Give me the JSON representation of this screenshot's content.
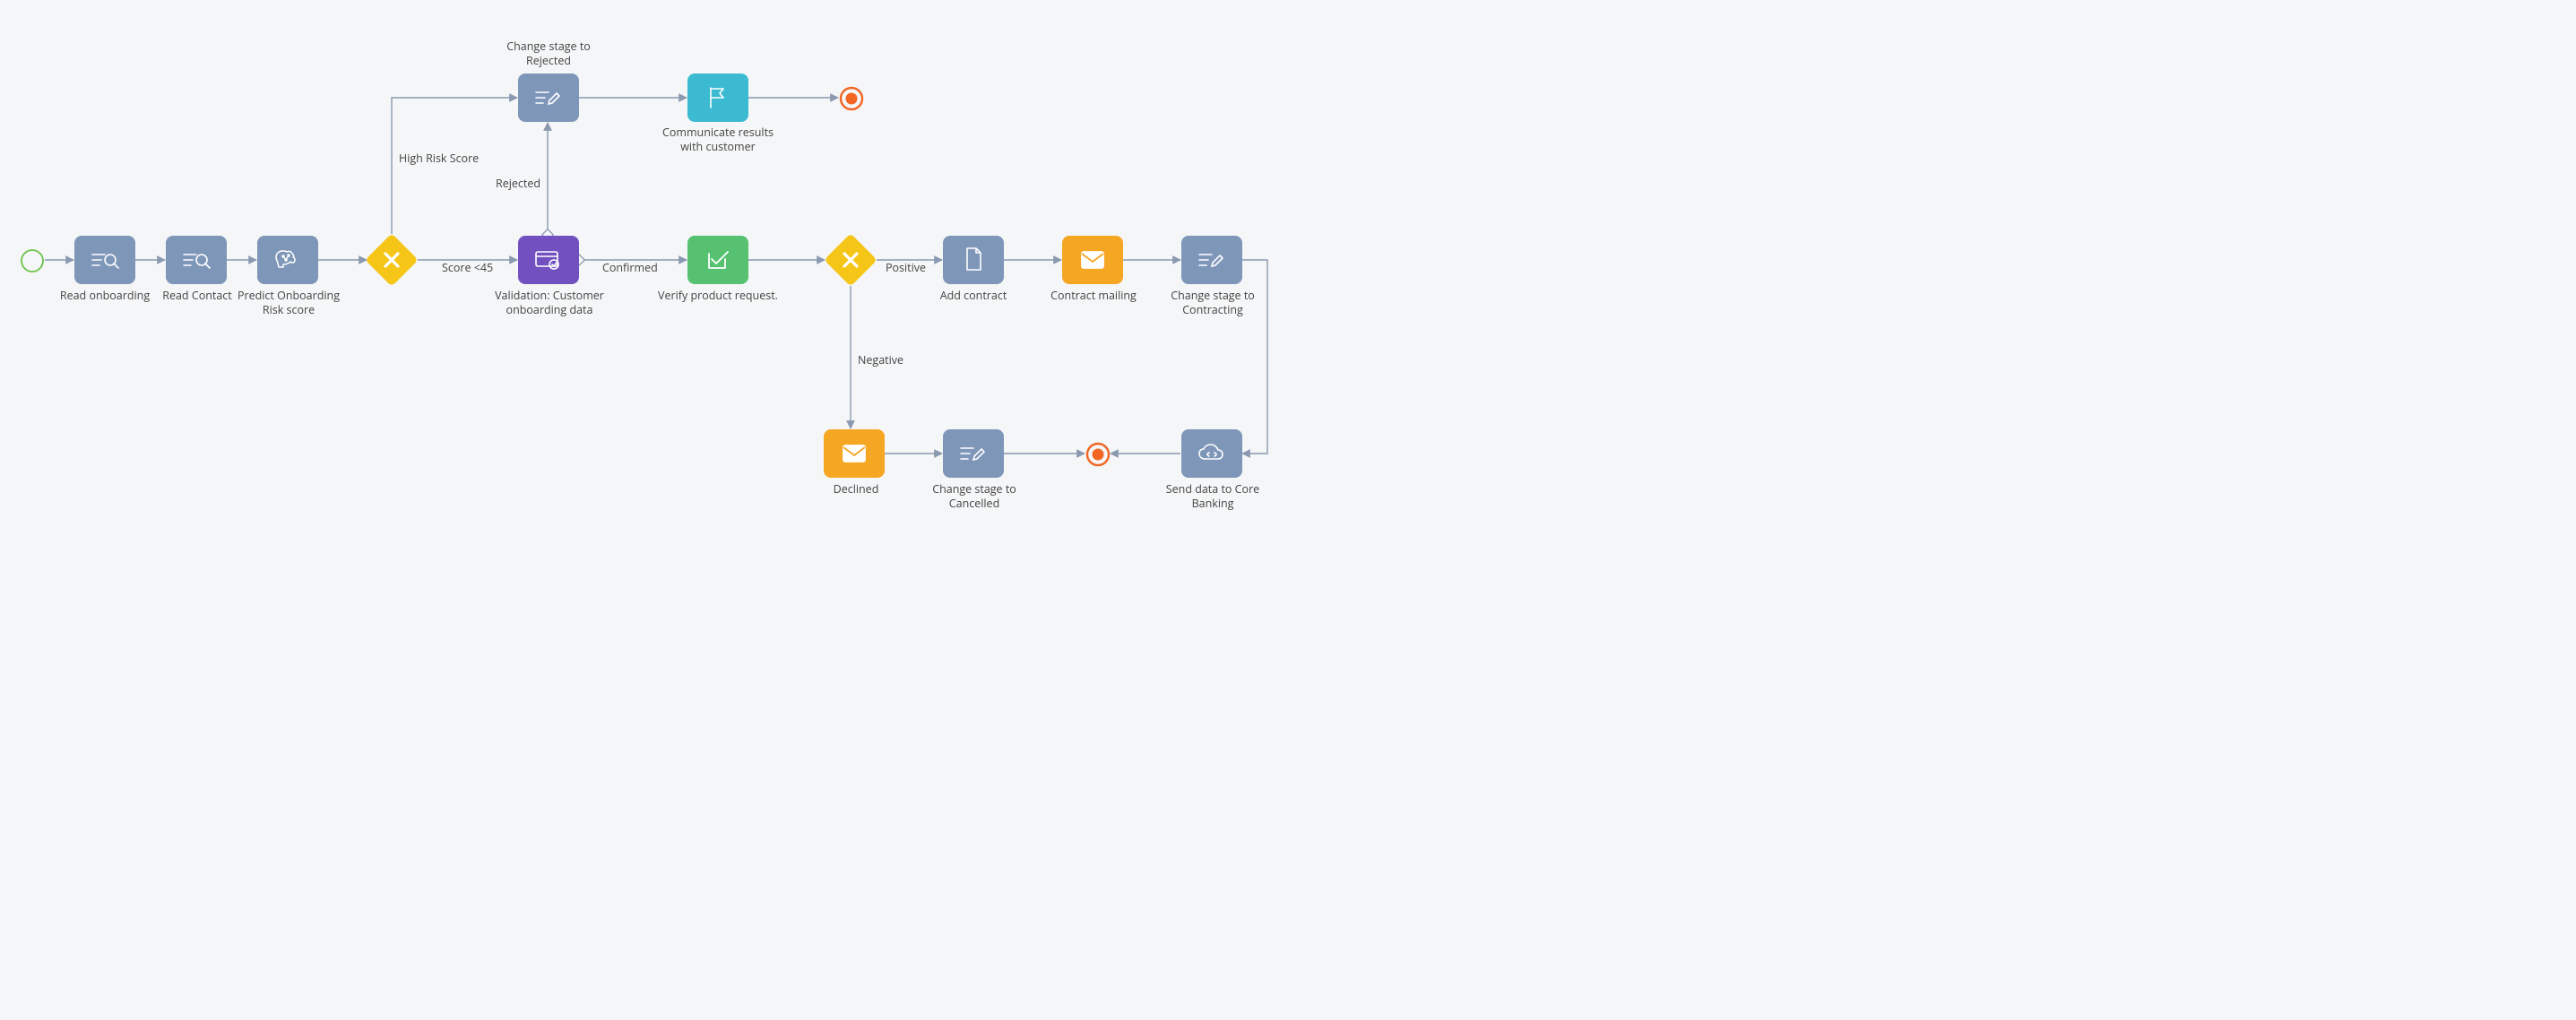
{
  "diagram": {
    "nodes": {
      "start": {
        "type": "start_event",
        "label": ""
      },
      "read_onboarding": {
        "type": "read_task",
        "label": "Read onboarding",
        "icon": "search-list"
      },
      "read_contact": {
        "type": "read_task",
        "label": "Read Contact",
        "icon": "search-list"
      },
      "predict_risk": {
        "type": "ml_task",
        "label": "Predict Onboarding Risk score",
        "icon": "brain"
      },
      "gateway_score": {
        "type": "exclusive_gateway",
        "label": ""
      },
      "change_stage_rejected": {
        "type": "script_task",
        "label": "Change stage to Rejected",
        "icon": "edit-list"
      },
      "validation": {
        "type": "user_task",
        "label": "Validation: Customer onboarding data",
        "icon": "card-check"
      },
      "communicate": {
        "type": "user_task",
        "label": "Communicate results with customer",
        "icon": "flag"
      },
      "terminate_top": {
        "type": "terminate_end",
        "label": ""
      },
      "verify_product": {
        "type": "service_task",
        "label": "Verify product request.",
        "icon": "check-box"
      },
      "gateway_verify": {
        "type": "exclusive_gateway",
        "label": ""
      },
      "add_contract": {
        "type": "service_task",
        "label": "Add contract",
        "icon": "document"
      },
      "contract_mailing": {
        "type": "send_task",
        "label": "Contract mailing",
        "icon": "mail"
      },
      "change_stage_contracting": {
        "type": "script_task",
        "label": "Change stage to Contracting",
        "icon": "edit-list"
      },
      "send_core_banking": {
        "type": "service_task",
        "label": "Send data to Core Banking",
        "icon": "cloud-code"
      },
      "terminate_mid": {
        "type": "terminate_end",
        "label": ""
      },
      "change_stage_cancelled": {
        "type": "script_task",
        "label": "Change stage to Cancelled",
        "icon": "edit-list"
      },
      "declined": {
        "type": "send_task",
        "label": "Declined",
        "icon": "mail"
      }
    },
    "edge_labels": {
      "high_risk": "High Risk Score",
      "score_lt_45": "Score <45",
      "rejected": "Rejected",
      "confirmed": "Confirmed",
      "positive": "Positive",
      "negative": "Negative"
    },
    "flows": [
      {
        "from": "start",
        "to": "read_onboarding"
      },
      {
        "from": "read_onboarding",
        "to": "read_contact"
      },
      {
        "from": "read_contact",
        "to": "predict_risk"
      },
      {
        "from": "predict_risk",
        "to": "gateway_score"
      },
      {
        "from": "gateway_score",
        "to": "change_stage_rejected",
        "label": "High_risk"
      },
      {
        "from": "gateway_score",
        "to": "validation",
        "label": "score_lt_45"
      },
      {
        "from": "validation",
        "to": "change_stage_rejected",
        "label": "rejected"
      },
      {
        "from": "validation",
        "to": "verify_product",
        "label": "confirmed"
      },
      {
        "from": "change_stage_rejected",
        "to": "communicate"
      },
      {
        "from": "communicate",
        "to": "terminate_top"
      },
      {
        "from": "verify_product",
        "to": "gateway_verify"
      },
      {
        "from": "gateway_verify",
        "to": "add_contract",
        "label": "positive"
      },
      {
        "from": "gateway_verify",
        "to": "declined",
        "label": "negative"
      },
      {
        "from": "add_contract",
        "to": "contract_mailing"
      },
      {
        "from": "contract_mailing",
        "to": "change_stage_contracting"
      },
      {
        "from": "change_stage_contracting",
        "to": "send_core_banking"
      },
      {
        "from": "send_core_banking",
        "to": "terminate_mid"
      },
      {
        "from": "declined",
        "to": "change_stage_cancelled"
      },
      {
        "from": "change_stage_cancelled",
        "to": "terminate_mid"
      }
    ]
  }
}
